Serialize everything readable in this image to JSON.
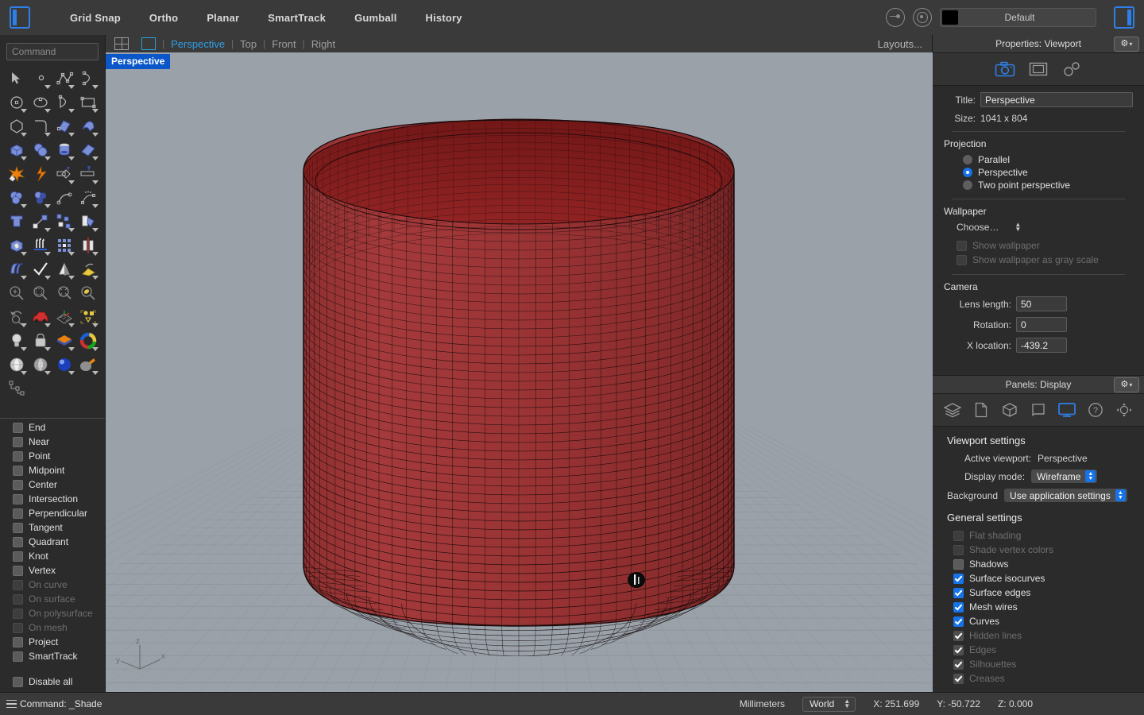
{
  "topbar": {
    "left_panel_toggle": "left-panel-toggle",
    "right_panel_toggle": "right-panel-toggle",
    "toggles": [
      {
        "label": "Grid Snap"
      },
      {
        "label": "Ortho"
      },
      {
        "label": "Planar"
      },
      {
        "label": "SmartTrack"
      },
      {
        "label": "Gumball"
      },
      {
        "label": "History"
      }
    ],
    "layer": {
      "name": "Default",
      "swatch_color": "#000000"
    }
  },
  "viewbar": {
    "tabs": [
      {
        "label": "Perspective",
        "active": true
      },
      {
        "label": "Top",
        "active": false
      },
      {
        "label": "Front",
        "active": false
      },
      {
        "label": "Right",
        "active": false
      }
    ],
    "separator": "|",
    "layouts_label": "Layouts..."
  },
  "viewport": {
    "label": "Perspective",
    "background_color": "#9aa1a9",
    "object_color": "#8e1c1c",
    "wire_color": "#141414",
    "grid_color": "#7f868f",
    "axis_gizmo": {
      "x": "x",
      "y": "y",
      "z": "z"
    }
  },
  "command_panel": {
    "placeholder": "Command"
  },
  "osnap": {
    "items": [
      {
        "label": "End",
        "checked": false,
        "enabled": true
      },
      {
        "label": "Near",
        "checked": false,
        "enabled": true
      },
      {
        "label": "Point",
        "checked": false,
        "enabled": true
      },
      {
        "label": "Midpoint",
        "checked": false,
        "enabled": true
      },
      {
        "label": "Center",
        "checked": false,
        "enabled": true
      },
      {
        "label": "Intersection",
        "checked": false,
        "enabled": true
      },
      {
        "label": "Perpendicular",
        "checked": false,
        "enabled": true
      },
      {
        "label": "Tangent",
        "checked": false,
        "enabled": true
      },
      {
        "label": "Quadrant",
        "checked": false,
        "enabled": true
      },
      {
        "label": "Knot",
        "checked": false,
        "enabled": true
      },
      {
        "label": "Vertex",
        "checked": false,
        "enabled": true
      },
      {
        "label": "On curve",
        "checked": false,
        "enabled": false
      },
      {
        "label": "On surface",
        "checked": false,
        "enabled": false
      },
      {
        "label": "On polysurface",
        "checked": false,
        "enabled": false
      },
      {
        "label": "On mesh",
        "checked": false,
        "enabled": false
      },
      {
        "label": "Project",
        "checked": false,
        "enabled": true
      },
      {
        "label": "SmartTrack",
        "checked": false,
        "enabled": true
      }
    ],
    "disable_all": {
      "label": "Disable all",
      "checked": false
    }
  },
  "properties_panel": {
    "title": "Properties: Viewport",
    "gear_label": "⚙",
    "chevron": "▾",
    "icons": [
      {
        "name": "camera-icon",
        "active": true
      },
      {
        "name": "frame-icon",
        "active": false
      },
      {
        "name": "links-icon",
        "active": false
      }
    ],
    "title_label": "Title:",
    "title_value": "Perspective",
    "size_label": "Size:",
    "size_value": "1041 x 804",
    "projection": {
      "heading": "Projection",
      "options": [
        {
          "label": "Parallel",
          "selected": false
        },
        {
          "label": "Perspective",
          "selected": true
        },
        {
          "label": "Two point perspective",
          "selected": false
        }
      ]
    },
    "wallpaper": {
      "heading": "Wallpaper",
      "choose_label": "Choose…",
      "show_wallpaper": {
        "label": "Show wallpaper",
        "checked": false,
        "enabled": false
      },
      "show_gray": {
        "label": "Show wallpaper as gray scale",
        "checked": false,
        "enabled": false
      }
    },
    "camera": {
      "heading": "Camera",
      "fields": [
        {
          "label": "Lens length:",
          "value": "50"
        },
        {
          "label": "Rotation:",
          "value": "0"
        },
        {
          "label": "X location:",
          "value": "-439.2"
        }
      ]
    }
  },
  "display_panel": {
    "title": "Panels: Display",
    "gear_label": "⚙",
    "chevron": "▾",
    "icons": [
      {
        "name": "layers-icon",
        "active": false
      },
      {
        "name": "notes-icon",
        "active": false
      },
      {
        "name": "object-properties-icon",
        "active": false
      },
      {
        "name": "rendering-icon",
        "active": false
      },
      {
        "name": "display-icon",
        "active": true
      },
      {
        "name": "help-icon",
        "active": false
      },
      {
        "name": "navigation-icon",
        "active": false
      }
    ],
    "viewport_settings": {
      "heading": "Viewport settings",
      "active_viewport_label": "Active viewport:",
      "active_viewport_value": "Perspective",
      "display_mode_label": "Display mode:",
      "display_mode_value": "Wireframe",
      "background_label": "Background",
      "background_value": "Use application settings"
    },
    "general_settings": {
      "heading": "General settings",
      "items": [
        {
          "label": "Flat shading",
          "checked": false,
          "enabled": false
        },
        {
          "label": "Shade vertex colors",
          "checked": false,
          "enabled": false
        },
        {
          "label": "Shadows",
          "checked": false,
          "enabled": true
        },
        {
          "label": "Surface isocurves",
          "checked": true,
          "enabled": true
        },
        {
          "label": "Surface edges",
          "checked": true,
          "enabled": true
        },
        {
          "label": "Mesh wires",
          "checked": true,
          "enabled": true
        },
        {
          "label": "Curves",
          "checked": true,
          "enabled": true
        },
        {
          "label": "Hidden lines",
          "checked": true,
          "enabled": false
        },
        {
          "label": "Edges",
          "checked": true,
          "enabled": false
        },
        {
          "label": "Silhouettes",
          "checked": true,
          "enabled": false
        },
        {
          "label": "Creases",
          "checked": true,
          "enabled": false
        }
      ]
    }
  },
  "statusbar": {
    "command_text": "Command: _Shade",
    "units": "Millimeters",
    "cplane": "World",
    "x": "X: 251.699",
    "y": "Y: -50.722",
    "z": "Z: 0.000"
  }
}
